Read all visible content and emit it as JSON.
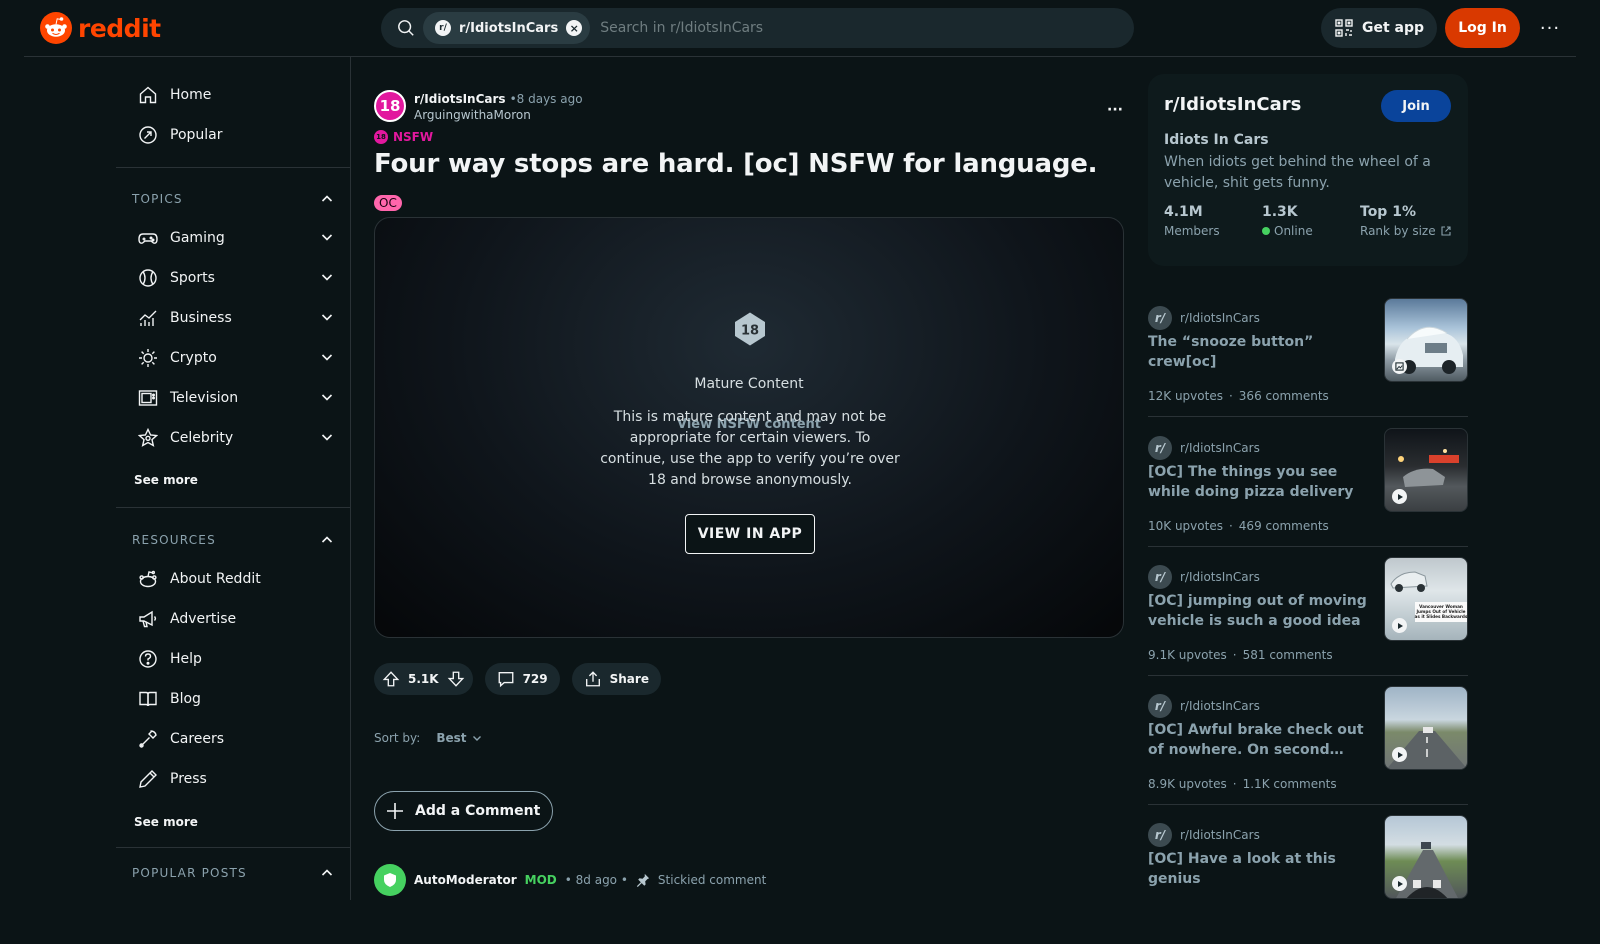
{
  "header": {
    "logo_text": "reddit",
    "search": {
      "chip_label": "r/IdiotsInCars",
      "placeholder": "Search in r/IdiotsInCars"
    },
    "get_app_label": "Get app",
    "login_label": "Log In",
    "overflow": "···"
  },
  "left_nav": {
    "primary": [
      {
        "label": "Home",
        "icon": "home-icon"
      },
      {
        "label": "Popular",
        "icon": "popular-icon"
      }
    ],
    "topics": {
      "heading": "TOPICS",
      "items": [
        {
          "label": "Gaming",
          "icon": "gamepad-icon"
        },
        {
          "label": "Sports",
          "icon": "ball-icon"
        },
        {
          "label": "Business",
          "icon": "chart-icon"
        },
        {
          "label": "Crypto",
          "icon": "sun-icon"
        },
        {
          "label": "Television",
          "icon": "tv-icon"
        },
        {
          "label": "Celebrity",
          "icon": "star-icon"
        }
      ],
      "see_more": "See more"
    },
    "resources": {
      "heading": "RESOURCES",
      "items": [
        {
          "label": "About Reddit",
          "icon": "reddit-alien-icon"
        },
        {
          "label": "Advertise",
          "icon": "megaphone-icon"
        },
        {
          "label": "Help",
          "icon": "help-icon"
        },
        {
          "label": "Blog",
          "icon": "book-icon"
        },
        {
          "label": "Careers",
          "icon": "wrench-icon"
        },
        {
          "label": "Press",
          "icon": "pen-icon"
        }
      ],
      "see_more": "See more"
    },
    "popular_posts": {
      "heading": "POPULAR POSTS"
    }
  },
  "post": {
    "subreddit": "r/IdiotsInCars",
    "sub_avatar": "18",
    "age": "•8 days ago",
    "author": "ArguingwithaMoron",
    "nsfw_label": "NSFW",
    "nsfw_dot": "18",
    "title": "Four way stops are hard. [oc] NSFW for language.",
    "flair": "OC",
    "media": {
      "badge": "18",
      "hidden_label": "View NSFW content",
      "mature_title": "Mature Content",
      "mature_desc": "This is mature content and may not be appropriate for certain viewers. To continue, use the app to verify you’re over 18 and browse anonymously.",
      "view_in_app": "VIEW IN APP"
    },
    "upvotes": "5.1K",
    "comments": "729",
    "share": "Share",
    "sort_label": "Sort by:",
    "sort_value": "Best",
    "add_comment": "Add a Comment",
    "first_comment": {
      "author": "AutoModerator",
      "mod_badge": "MOD",
      "age": "• 8d ago •",
      "stickied": "Stickied comment"
    },
    "overflow": "···"
  },
  "sidebar": {
    "sub_card": {
      "name": "r/IdiotsInCars",
      "join": "Join",
      "title": "Idiots In Cars",
      "description": "When idiots get behind the wheel of a vehicle, shit gets funny.",
      "stats": [
        {
          "value": "4.1M",
          "label": "Members"
        },
        {
          "value": "1.3K",
          "label": "Online"
        },
        {
          "value": "Top 1%",
          "label": "Rank by size"
        }
      ]
    },
    "related": [
      {
        "sub": "r/IdiotsInCars",
        "title": "The “snooze button” crew[oc]",
        "upvotes": "12K upvotes",
        "comments": "366 comments",
        "thumb": "gallery"
      },
      {
        "sub": "r/IdiotsInCars",
        "title": "[OC] The things you see while doing pizza delivery",
        "upvotes": "10K upvotes",
        "comments": "469 comments",
        "thumb": "video"
      },
      {
        "sub": "r/IdiotsInCars",
        "title": "[OC] jumping out of moving vehicle is such a good idea",
        "upvotes": "9.1K upvotes",
        "comments": "581 comments",
        "thumb": "video",
        "thumb_caption": "Vancouver Woman Jumps Out of Vehicle as it Slides Backwards"
      },
      {
        "sub": "r/IdiotsInCars",
        "title": "[OC] Awful brake check out of nowhere. On second take, it's a fake",
        "upvotes": "8.9K upvotes",
        "comments": "1.1K comments",
        "thumb": "video"
      },
      {
        "sub": "r/IdiotsInCars",
        "title": "[OC] Have a look at this genius",
        "upvotes": "",
        "comments": "",
        "thumb": "video"
      }
    ],
    "stat_sep": "·"
  },
  "colors": {
    "brand": "#ff4500",
    "login": "#d93900",
    "join": "#0a449b",
    "nsfw": "#e2189e",
    "mod": "#46d160",
    "flair": "#ff66ac"
  }
}
